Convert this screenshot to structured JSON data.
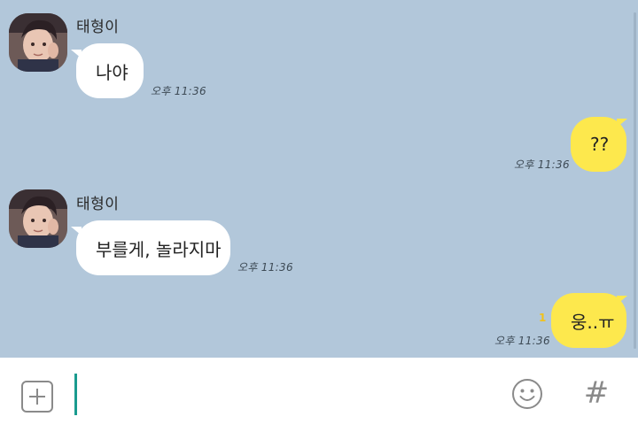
{
  "messages": [
    {
      "sender": "태형이",
      "text": "나야",
      "time": "오후 11:36",
      "direction": "in"
    },
    {
      "text": "??",
      "time": "오후 11:36",
      "direction": "out"
    },
    {
      "sender": "태형이",
      "text": "부를게, 놀라지마",
      "time": "오후 11:36",
      "direction": "in"
    },
    {
      "text": "웅..ㅠ",
      "time": "오후 11:36",
      "unread": "1",
      "direction": "out"
    }
  ],
  "input": {
    "placeholder": ""
  },
  "icons": {
    "attach": "plus-icon",
    "emoticon": "smiley-icon",
    "hashtag": "hash-icon"
  },
  "hash_glyph": "#",
  "colors": {
    "chat_background": "#b2c7da",
    "incoming_bubble": "#ffffff",
    "outgoing_bubble": "#fde84d",
    "caret": "#1a9b8f"
  }
}
